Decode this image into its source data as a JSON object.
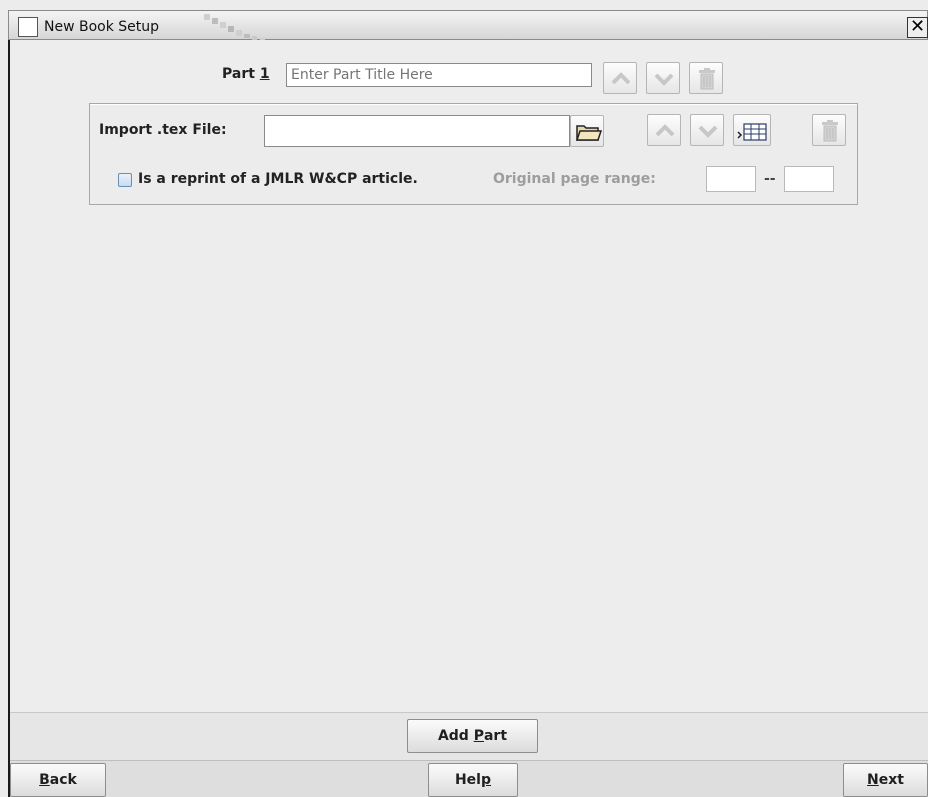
{
  "window": {
    "title": "New Book Setup"
  },
  "part": {
    "label": "Part ",
    "number": "1",
    "title_placeholder": "Enter Part Title Here"
  },
  "import": {
    "label": "Import .tex File:",
    "file_value": "",
    "reprint_label": "Is a reprint of a JMLR W&CP article.",
    "reprint_checked": false,
    "page_range_label": "Original page range:",
    "range_separator": "--",
    "range_start": "",
    "range_end": ""
  },
  "buttons": {
    "add_part": {
      "pre": "Add ",
      "mnemonic": "P",
      "post": "art"
    },
    "back": {
      "pre": "",
      "mnemonic": "B",
      "post": "ack"
    },
    "help": {
      "pre": "Hel",
      "mnemonic": "p",
      "post": ""
    },
    "next": {
      "pre": "",
      "mnemonic": "N",
      "post": "ext"
    }
  },
  "icons": {
    "window": "window-box-icon",
    "close": "close-icon",
    "up": "move-up-icon",
    "down": "move-down-icon",
    "delete": "trash-icon",
    "folder": "folder-icon",
    "insert": "insert-table-icon"
  },
  "colors": {
    "background": "#ececec",
    "disabled_text": "#9d9d9d",
    "checkbox": "#c7dbef"
  }
}
